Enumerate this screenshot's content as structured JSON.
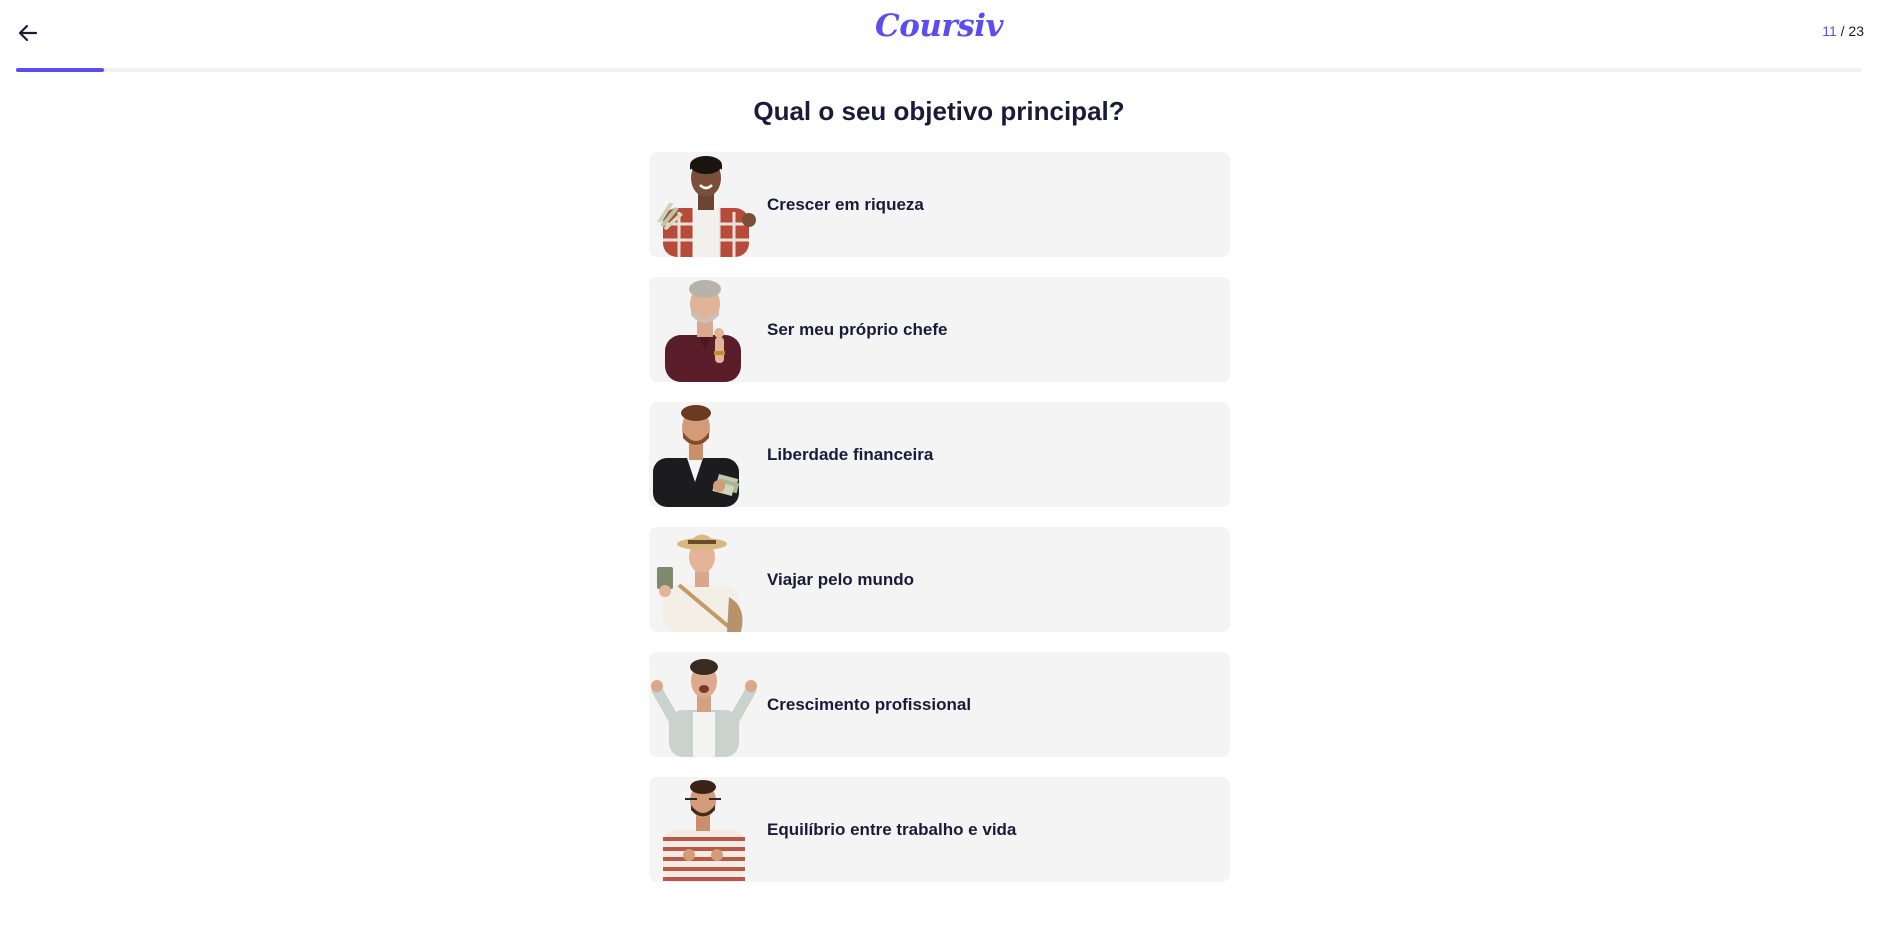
{
  "header": {
    "logo_text": "Coursiv",
    "step_current": "11",
    "step_separator": " / ",
    "step_total": "23",
    "progress_fraction": 0.0478
  },
  "colors": {
    "accent": "#5b4df0",
    "text": "#1b1a3a",
    "option_bg": "#f4f4f4"
  },
  "question": {
    "title": "Qual o seu objetivo principal?"
  },
  "options": [
    {
      "label": "Crescer em riqueza",
      "image": "man-holding-cash-plaid-shirt"
    },
    {
      "label": "Ser meu próprio chefe",
      "image": "bearded-man-maroon-shirt"
    },
    {
      "label": "Liberdade financeira",
      "image": "man-black-suit-holding-money"
    },
    {
      "label": "Viajar pelo mundo",
      "image": "man-straw-hat-passport"
    },
    {
      "label": "Crescimento profissional",
      "image": "man-fists-raised-celebrating"
    },
    {
      "label": "Equilíbrio entre trabalho e vida",
      "image": "man-striped-sweater-meditating"
    }
  ]
}
